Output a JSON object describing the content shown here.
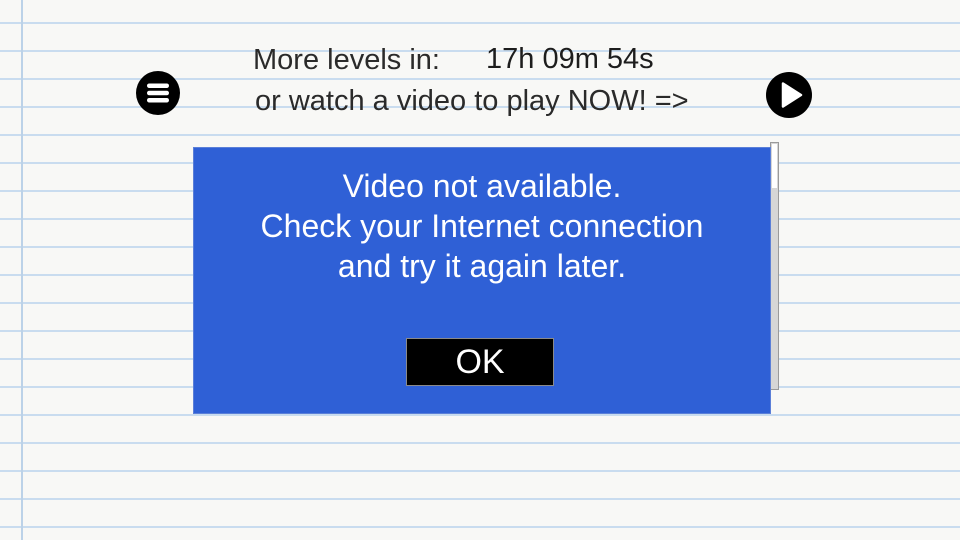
{
  "header": {
    "more_levels_label": "More levels in:",
    "timer": "17h 09m 54s",
    "watch_video_prompt": "or watch a video to play NOW! =>"
  },
  "icons": {
    "menu": "menu-icon",
    "play": "play-icon"
  },
  "dialog": {
    "lines": [
      "Video not available.",
      "Check your Internet connection",
      "and try it again later."
    ],
    "ok_label": "OK"
  },
  "colors": {
    "dialog_background": "#2f60d6",
    "ok_button": "#000000",
    "paper": "#f8f8f6",
    "ruled_line": "#c9dcef",
    "text": "#2a2a2a"
  }
}
